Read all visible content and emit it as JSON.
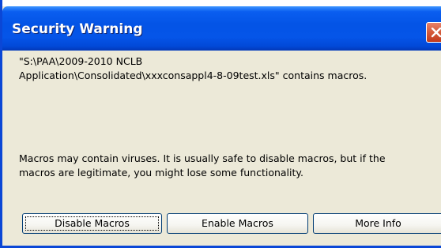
{
  "window": {
    "title": "Security Warning",
    "close_icon": "close-icon",
    "close_color": "#d45a3a",
    "titlebar_color": "#0454e6"
  },
  "message": {
    "line1": "\"S:\\PAA\\2009-2010 NCLB",
    "line2": "Application\\Consolidated\\xxxconsappl4-8-09test.xls\" contains macros.",
    "line3": "Macros may contain viruses. It is usually safe to disable macros, but if the",
    "line4": "macros are legitimate, you might lose some functionality."
  },
  "buttons": {
    "disable_label": "Disable Macros",
    "enable_label": "Enable Macros",
    "more_info_label": "More Info"
  }
}
